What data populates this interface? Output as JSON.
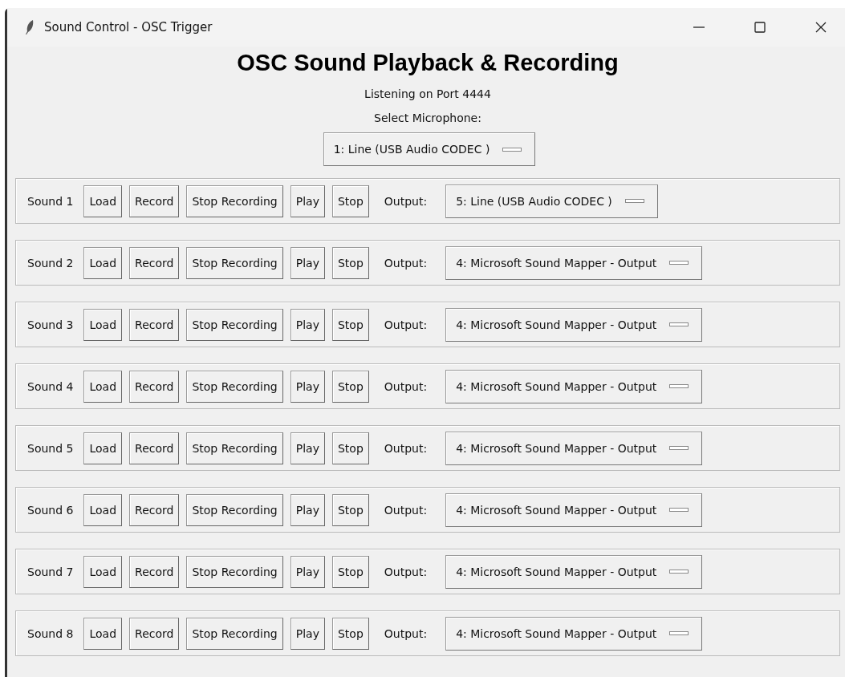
{
  "window": {
    "title": "Sound Control - OSC Trigger"
  },
  "heading": "OSC Sound Playback & Recording",
  "status": "Listening on Port 4444",
  "microphone": {
    "label": "Select Microphone:",
    "value": "1: Line (USB Audio CODEC )"
  },
  "sounds": [
    {
      "name": "Sound 1",
      "buttons": [
        "Load",
        "Record",
        "Stop Recording",
        "Play",
        "Stop"
      ],
      "output_label": "Output:",
      "output": "5: Line (USB Audio CODEC )"
    },
    {
      "name": "Sound 2",
      "buttons": [
        "Load",
        "Record",
        "Stop Recording",
        "Play",
        "Stop"
      ],
      "output_label": "Output:",
      "output": "4: Microsoft Sound Mapper - Output"
    },
    {
      "name": "Sound 3",
      "buttons": [
        "Load",
        "Record",
        "Stop Recording",
        "Play",
        "Stop"
      ],
      "output_label": "Output:",
      "output": "4: Microsoft Sound Mapper - Output"
    },
    {
      "name": "Sound 4",
      "buttons": [
        "Load",
        "Record",
        "Stop Recording",
        "Play",
        "Stop"
      ],
      "output_label": "Output:",
      "output": "4: Microsoft Sound Mapper - Output"
    },
    {
      "name": "Sound 5",
      "buttons": [
        "Load",
        "Record",
        "Stop Recording",
        "Play",
        "Stop"
      ],
      "output_label": "Output:",
      "output": "4: Microsoft Sound Mapper - Output"
    },
    {
      "name": "Sound 6",
      "buttons": [
        "Load",
        "Record",
        "Stop Recording",
        "Play",
        "Stop"
      ],
      "output_label": "Output:",
      "output": "4: Microsoft Sound Mapper - Output"
    },
    {
      "name": "Sound 7",
      "buttons": [
        "Load",
        "Record",
        "Stop Recording",
        "Play",
        "Stop"
      ],
      "output_label": "Output:",
      "output": "4: Microsoft Sound Mapper - Output"
    },
    {
      "name": "Sound 8",
      "buttons": [
        "Load",
        "Record",
        "Stop Recording",
        "Play",
        "Stop"
      ],
      "output_label": "Output:",
      "output": "4: Microsoft Sound Mapper - Output"
    }
  ]
}
